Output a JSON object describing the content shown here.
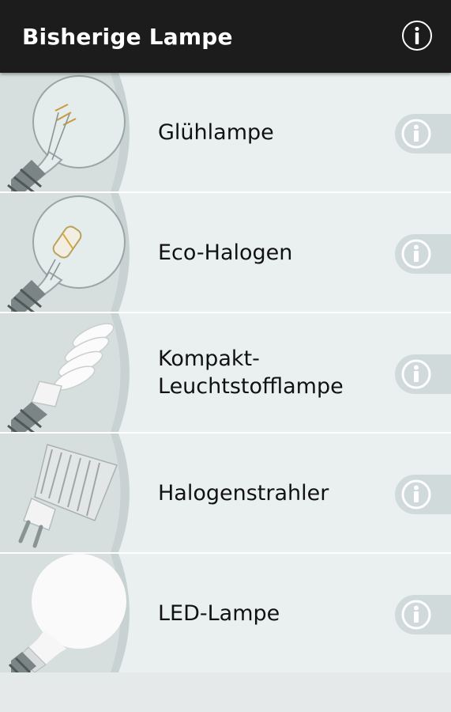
{
  "app_bar": {
    "title": "Bisherige Lampe",
    "info_icon": "info-circle-icon",
    "background": "#1c1c1c"
  },
  "lamps": [
    {
      "label": "Glühlampe",
      "icon": "incandescent-bulb-icon",
      "info_icon": "info-icon"
    },
    {
      "label": "Eco-Halogen",
      "icon": "eco-halogen-bulb-icon",
      "info_icon": "info-icon"
    },
    {
      "label": "Kompakt-\nLeuchtstofflampe",
      "icon": "compact-fluorescent-bulb-icon",
      "info_icon": "info-icon"
    },
    {
      "label": "Halogenstrahler",
      "icon": "halogen-spot-icon",
      "info_icon": "info-icon"
    },
    {
      "label": "LED-Lampe",
      "icon": "led-bulb-icon",
      "info_icon": "info-icon"
    }
  ],
  "colors": {
    "row_background": "#eaf0f0",
    "thumb_background": "#c7d0d0",
    "info_badge": "#d2dcdc"
  }
}
